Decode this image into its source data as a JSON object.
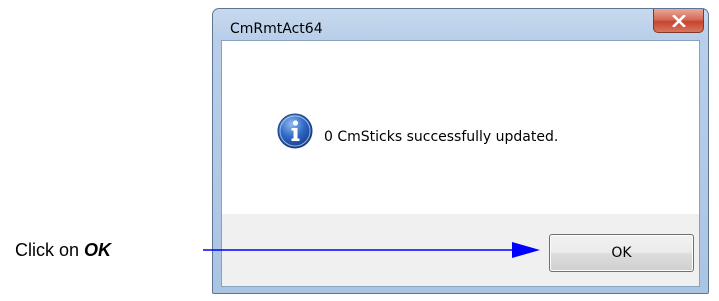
{
  "dialog": {
    "title": "CmRmtAct64",
    "close_icon": "close-icon",
    "message_icon": "info-icon",
    "message": "0 CmSticks successfully updated.",
    "ok_label": "OK"
  },
  "annotation": {
    "prefix": "Click on ",
    "emphasis": "OK",
    "arrow_color": "#0000ff"
  }
}
